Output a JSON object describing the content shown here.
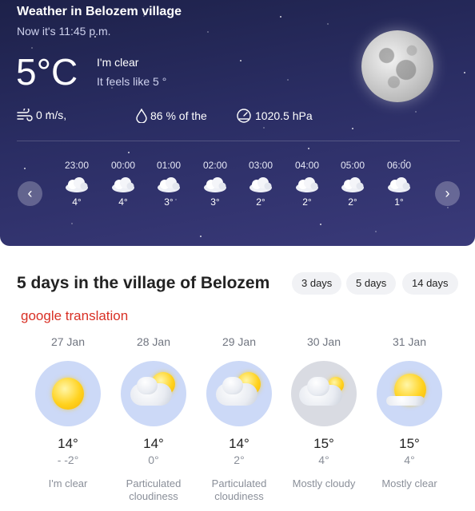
{
  "now": {
    "title": "Weather in Belozem village",
    "time_text": "Now it's 11:45 p.m.",
    "temperature": "5°C",
    "condition": "I'm clear",
    "feels_like": "It feels like 5 °",
    "wind": "0 m/s,",
    "humidity": "86 % of the",
    "pressure": "1020.5 hPa",
    "moon_icon": "full-moon-icon"
  },
  "hourly": [
    {
      "time": "23:00",
      "temp": "4°",
      "icon": "cloud-icon"
    },
    {
      "time": "00:00",
      "temp": "4°",
      "icon": "cloud-icon"
    },
    {
      "time": "01:00",
      "temp": "3°",
      "icon": "cloud-icon"
    },
    {
      "time": "02:00",
      "temp": "3°",
      "icon": "cloud-icon"
    },
    {
      "time": "03:00",
      "temp": "2°",
      "icon": "cloud-icon"
    },
    {
      "time": "04:00",
      "temp": "2°",
      "icon": "cloud-icon"
    },
    {
      "time": "05:00",
      "temp": "2°",
      "icon": "cloud-icon"
    },
    {
      "time": "06:00",
      "temp": "1°",
      "icon": "cloud-icon"
    }
  ],
  "nav": {
    "prev": "‹",
    "next": "›"
  },
  "forecast": {
    "title": "5 days in the village of Belozem",
    "tabs": [
      "3 days",
      "5 days",
      "14 days"
    ],
    "translation_note": "google translation",
    "days": [
      {
        "date": "27 Jan",
        "high": "14°",
        "low": "- -2°",
        "desc": "I'm clear",
        "icon": "sun-icon"
      },
      {
        "date": "28 Jan",
        "high": "14°",
        "low": "0°",
        "desc": "Particulated cloudiness",
        "icon": "partly-cloudy-icon"
      },
      {
        "date": "29 Jan",
        "high": "14°",
        "low": "2°",
        "desc": "Particulated cloudiness",
        "icon": "partly-cloudy-icon"
      },
      {
        "date": "30 Jan",
        "high": "15°",
        "low": "4°",
        "desc": "Mostly cloudy",
        "icon": "mostly-cloudy-icon"
      },
      {
        "date": "31 Jan",
        "high": "15°",
        "low": "4°",
        "desc": "Mostly clear",
        "icon": "mostly-clear-icon"
      }
    ]
  },
  "colors": {
    "night_bg": "#2a2d63",
    "day_icon_bg": "#ccd9f7",
    "cloudy_icon_bg": "#d9dbe2",
    "translation_red": "#d93025"
  }
}
